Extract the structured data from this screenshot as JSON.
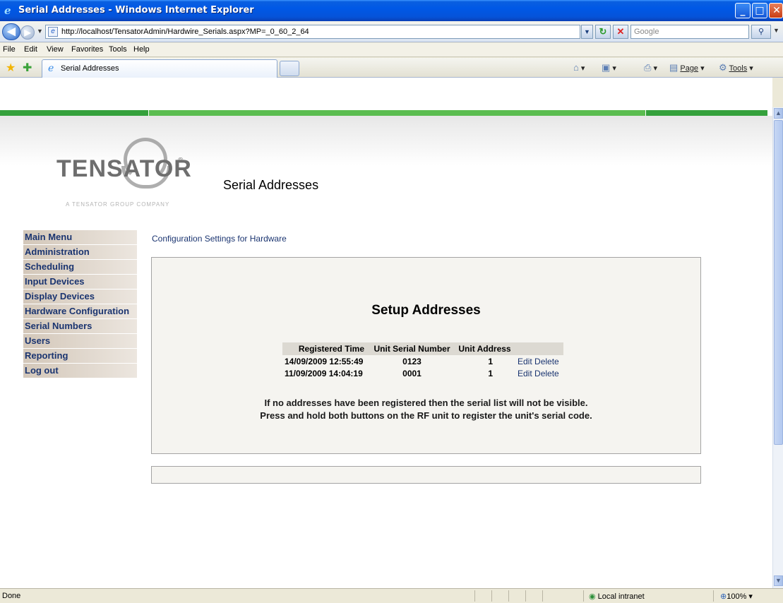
{
  "window": {
    "title": "Serial Addresses - Windows Internet Explorer"
  },
  "addressbar": {
    "url": "http://localhost/TensatorAdmin/Hardwire_Serials.aspx?MP=_0_60_2_64",
    "search_placeholder": "Google"
  },
  "menubar": {
    "items": [
      "File",
      "Edit",
      "View",
      "Favorites",
      "Tools",
      "Help"
    ]
  },
  "tabs": {
    "active_label": "Serial Addresses"
  },
  "commandbar": {
    "page_label": "Page",
    "tools_label": "Tools"
  },
  "logo": {
    "word": "TENSATOR",
    "reg": "®",
    "tagline": "A TENSATOR GROUP COMPANY"
  },
  "page": {
    "title": "Serial Addresses",
    "config_label": "Configuration Settings for Hardware"
  },
  "sidebar": {
    "items": [
      "Main Menu",
      "Administration",
      "Scheduling",
      "Input Devices",
      "Display Devices",
      "Hardware Configuration",
      "Serial Numbers",
      "Users",
      "Reporting",
      "Log out"
    ]
  },
  "setup": {
    "title": "Setup Addresses",
    "headers": {
      "time": "Registered Time",
      "serial": "Unit Serial Number",
      "address": "Unit Address"
    },
    "rows": [
      {
        "time": "14/09/2009 12:55:49",
        "serial": "0123",
        "address": "1",
        "edit": "Edit",
        "delete": "Delete"
      },
      {
        "time": "11/09/2009 14:04:19",
        "serial": "0001",
        "address": "1",
        "edit": "Edit",
        "delete": "Delete"
      }
    ],
    "note_line1": "If no addresses have been registered then the serial list will not be visible.",
    "note_line2": "Press and hold both buttons on the RF unit to register the unit's serial code."
  },
  "statusbar": {
    "status": "Done",
    "zone": "Local intranet",
    "zoom": "100%"
  },
  "colors": {
    "titlebar": "#0058e6",
    "green_bar": "#35a13c",
    "menu_item_bg": "#d3c7b9",
    "link": "#1a3470"
  }
}
